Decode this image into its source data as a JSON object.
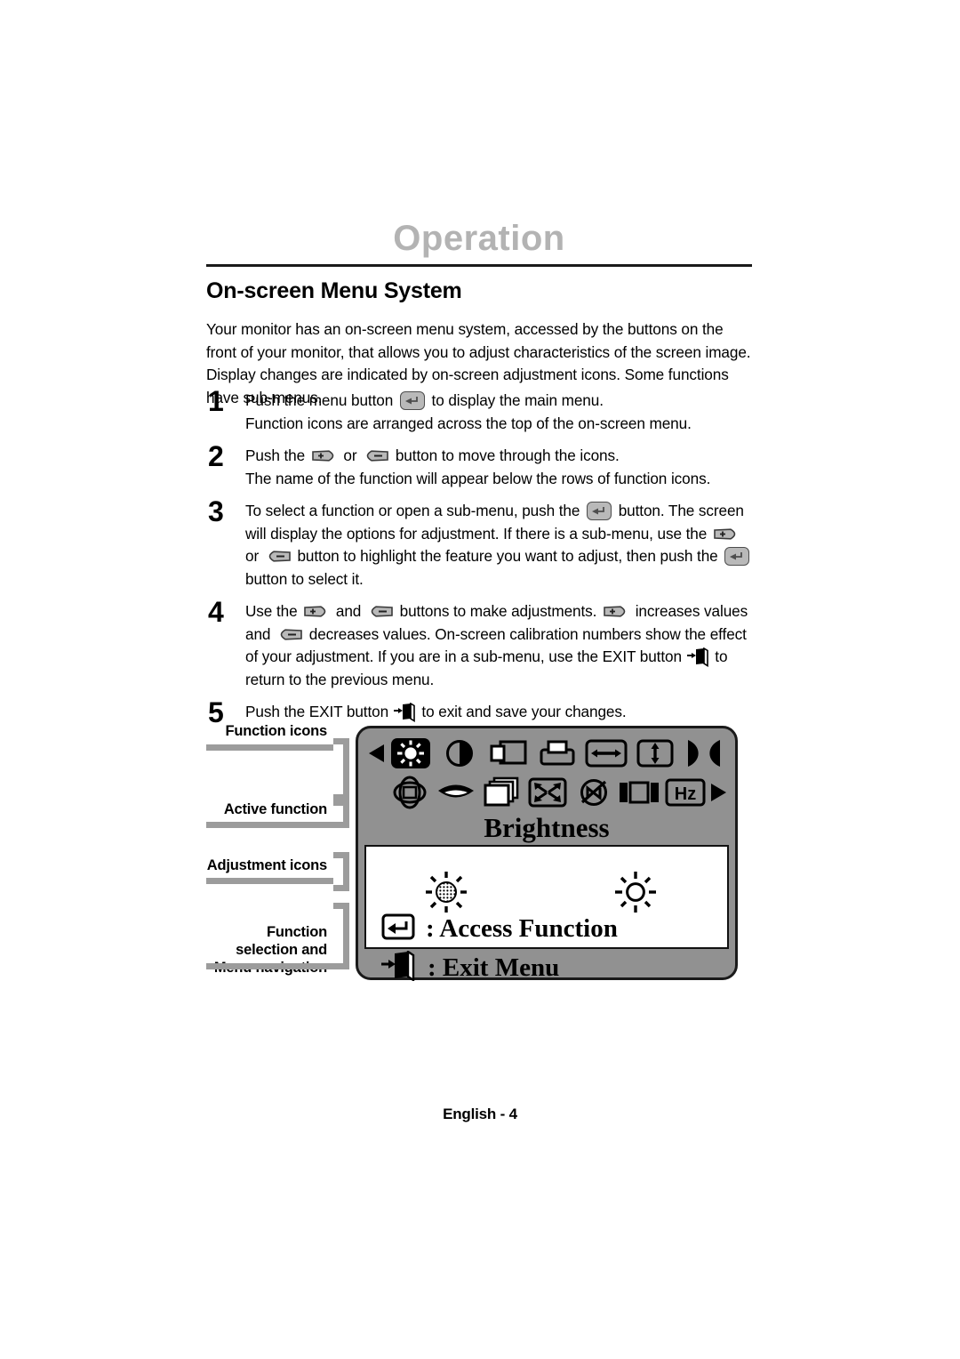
{
  "header": {
    "chapter_title": "Operation",
    "section_title": "On-screen Menu System"
  },
  "intro": "Your monitor has an on-screen menu system, accessed by the buttons on the front of your monitor, that allows you to adjust characteristics of the screen image. Display changes are indicated by on-screen adjustment icons. Some functions have sub-menus.",
  "steps": [
    {
      "number": "1",
      "parts": [
        {
          "text": "Push the menu button "
        },
        {
          "icon": "menu-button-icon"
        },
        {
          "text": " to display the main menu."
        },
        {
          "break": true
        },
        {
          "text": "Function icons are arranged across the top of the on-screen menu."
        }
      ]
    },
    {
      "number": "2",
      "parts": [
        {
          "text": "Push the "
        },
        {
          "icon": "plus-button-icon"
        },
        {
          "text": " or "
        },
        {
          "icon": "minus-button-icon"
        },
        {
          "text": " button to move through the icons."
        },
        {
          "break": true
        },
        {
          "text": "The name of the function will appear below the rows of function icons."
        }
      ]
    },
    {
      "number": "3",
      "parts": [
        {
          "text": "To select a function or open a sub-menu, push the "
        },
        {
          "icon": "menu-button-icon"
        },
        {
          "text": " button. The screen will display the options for adjustment. If there is a sub-menu, use the "
        },
        {
          "icon": "plus-button-icon"
        },
        {
          "text": " or "
        },
        {
          "icon": "minus-button-icon"
        },
        {
          "text": " button to highlight the feature you want to adjust, then push the "
        },
        {
          "icon": "menu-button-icon"
        },
        {
          "text": " button to select it."
        }
      ]
    },
    {
      "number": "4",
      "parts": [
        {
          "text": "Use the "
        },
        {
          "icon": "plus-button-icon"
        },
        {
          "text": " and "
        },
        {
          "icon": "minus-button-icon"
        },
        {
          "text": " buttons to make adjustments. "
        },
        {
          "icon": "plus-button-icon"
        },
        {
          "text": " increases values and "
        },
        {
          "icon": "minus-button-icon"
        },
        {
          "text": " decreases values. On-screen calibration numbers show the effect of your adjustment. If you are in a sub-menu, use the EXIT button "
        },
        {
          "icon": "exit-button-icon"
        },
        {
          "text": " to return to the previous menu."
        }
      ]
    },
    {
      "number": "5",
      "parts": [
        {
          "text": "Push the EXIT button "
        },
        {
          "icon": "exit-button-icon"
        },
        {
          "text": " to exit and save your changes."
        }
      ]
    }
  ],
  "diagram": {
    "callouts": [
      {
        "label": "Function icons"
      },
      {
        "label": "Active function"
      },
      {
        "label": "Adjustment icons"
      },
      {
        "label": "Function\nselection and\nMenu navigation"
      }
    ],
    "osd": {
      "active_function": "Brightness",
      "access_label": ": Access Function",
      "exit_label": ": Exit Menu",
      "row1_icons": [
        "nav-left-arrow-icon",
        "brightness-icon",
        "contrast-icon",
        "horizontal-position-icon",
        "vertical-position-icon",
        "horizontal-size-icon",
        "vertical-size-icon",
        "pincushion-icon"
      ],
      "row2_icons": [
        "rotation-icon",
        "moire-icon",
        "osd-position-icon",
        "zoom-icon",
        "degauss-icon",
        "parallelogram-icon",
        "frequency-hz-icon",
        "nav-right-arrow-icon"
      ],
      "adjust_icons": [
        "brightness-decrease-icon",
        "brightness-increase-icon"
      ],
      "hz_label": "Hz",
      "legend_access_icon": "enter-key-icon",
      "legend_exit_icon": "exit-door-icon"
    }
  },
  "footer": "English - 4",
  "colors": {
    "chapter_title": "#b3b3b3",
    "osd_background": "#919191",
    "callout_bar": "#9c9c9c",
    "ink": "#000000"
  }
}
